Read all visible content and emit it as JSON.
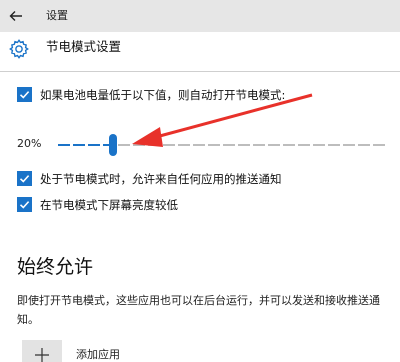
{
  "window": {
    "title": "设置"
  },
  "header": {
    "title": "节电模式设置",
    "icon": "gear-icon"
  },
  "settings": {
    "auto_battery_saver": {
      "label": "如果电池电量低于以下值，则自动打开节电模式:",
      "checked": true
    },
    "threshold": {
      "value_label": "20%",
      "value": 20,
      "min": 5,
      "max": 100
    },
    "allow_push": {
      "label": "处于节电模式时，允许来自任何应用的推送通知",
      "checked": true
    },
    "lower_brightness": {
      "label": "在节电模式下屏幕亮度较低",
      "checked": true
    }
  },
  "always_allowed": {
    "title": "始终允许",
    "description": "即使打开节电模式，这些应用也可以在后台运行，并可以发送和接收推送通知。",
    "add_app_label": "添加应用"
  },
  "colors": {
    "accent": "#1a73c8",
    "arrow": "#e8312a",
    "titlebar": "#e6e6e6"
  }
}
